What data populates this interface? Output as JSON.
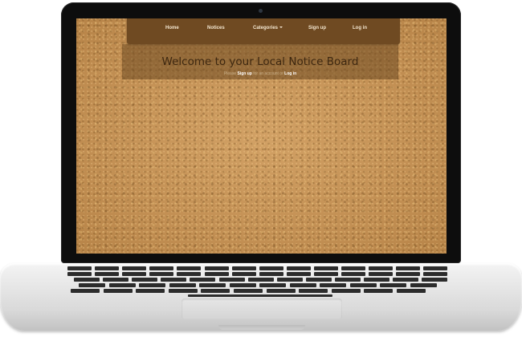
{
  "navbar": {
    "items": [
      {
        "label": "Home"
      },
      {
        "label": "Notices"
      },
      {
        "label": "Categories"
      },
      {
        "label": "Sign up"
      },
      {
        "label": "Log in"
      }
    ]
  },
  "banner": {
    "title": "Welcome to your Local Notice Board",
    "sub_prefix": "Please",
    "sub_signup": "Sign up",
    "sub_middle": "for an account or",
    "sub_login": "Log in"
  },
  "colors": {
    "cork": "#c8975a",
    "navbar": "#6f4a22",
    "title": "#3d2710"
  }
}
